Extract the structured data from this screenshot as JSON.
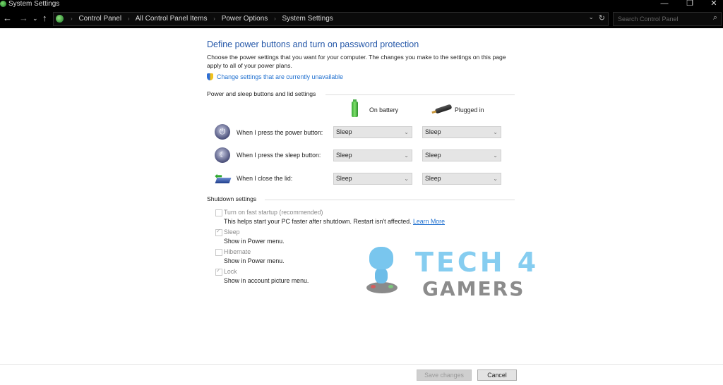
{
  "window": {
    "title": "System Settings",
    "controls": {
      "minimize": "—",
      "restore": "❐",
      "close": "✕"
    }
  },
  "nav": {
    "back": "←",
    "forward": "→",
    "recent": "⌄",
    "up": "↑",
    "breadcrumbs": [
      "Control Panel",
      "All Control Panel Items",
      "Power Options",
      "System Settings"
    ],
    "breadcrumb_separator": "›",
    "dropdown": "⌄",
    "refresh": "↻",
    "search_placeholder": "Search Control Panel",
    "search_icon": "⌕"
  },
  "page": {
    "title": "Define power buttons and turn on password protection",
    "intro": "Choose the power settings that you want for your computer. The changes you make to the settings on this page apply to all of your power plans.",
    "uac_link": "Change settings that are currently unavailable"
  },
  "power_section": {
    "heading": "Power and sleep buttons and lid settings",
    "columns": [
      "On battery",
      "Plugged in"
    ],
    "rows": [
      {
        "icon": "power-button-icon",
        "label": "When I press the power button:",
        "on_battery": "Sleep",
        "plugged_in": "Sleep"
      },
      {
        "icon": "sleep-button-icon",
        "label": "When I press the sleep button:",
        "on_battery": "Sleep",
        "plugged_in": "Sleep"
      },
      {
        "icon": "lid-icon",
        "label": "When I close the lid:",
        "on_battery": "Sleep",
        "plugged_in": "Sleep"
      }
    ]
  },
  "shutdown_section": {
    "heading": "Shutdown settings",
    "options": [
      {
        "label": "Turn on fast startup (recommended)",
        "checked": false,
        "description": "This helps start your PC faster after shutdown. Restart isn't affected.",
        "link": "Learn More"
      },
      {
        "label": "Sleep",
        "checked": true,
        "description": "Show in Power menu."
      },
      {
        "label": "Hibernate",
        "checked": false,
        "description": "Show in Power menu."
      },
      {
        "label": "Lock",
        "checked": true,
        "description": "Show in account picture menu."
      }
    ]
  },
  "watermark": {
    "line1": "TECH 4",
    "line2": "GAMERS"
  },
  "footer": {
    "save": "Save changes",
    "cancel": "Cancel"
  },
  "colors": {
    "link": "#1e6fcf",
    "heading": "#2457a8",
    "titlebar": "#000000"
  }
}
